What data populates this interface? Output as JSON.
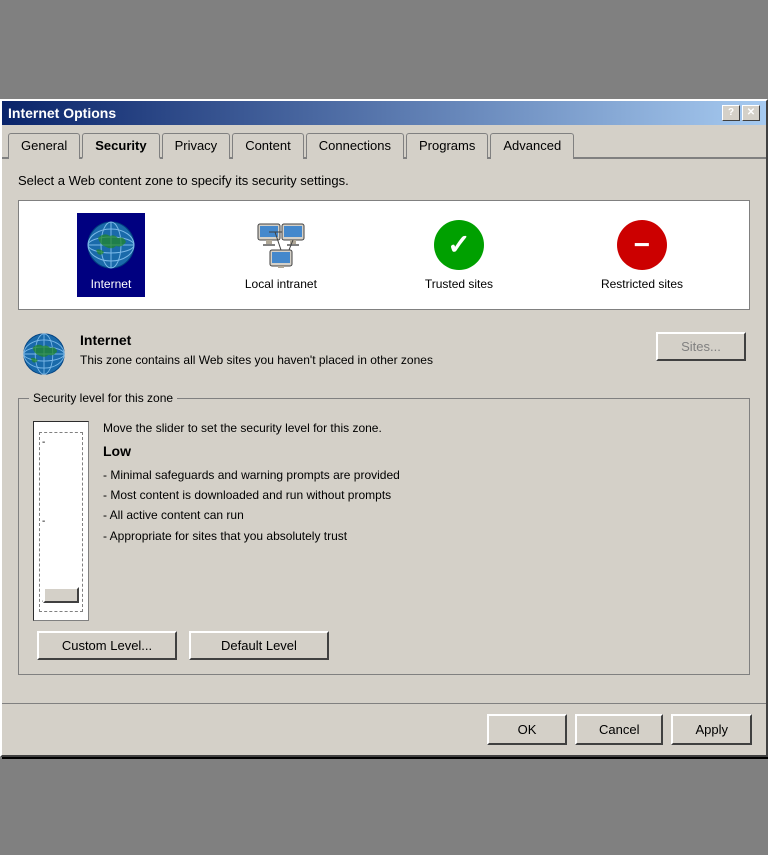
{
  "window": {
    "title": "Internet Options",
    "help_btn": "?",
    "close_btn": "✕"
  },
  "tabs": [
    {
      "id": "general",
      "label": "General"
    },
    {
      "id": "security",
      "label": "Security",
      "active": true
    },
    {
      "id": "privacy",
      "label": "Privacy"
    },
    {
      "id": "content",
      "label": "Content"
    },
    {
      "id": "connections",
      "label": "Connections"
    },
    {
      "id": "programs",
      "label": "Programs"
    },
    {
      "id": "advanced",
      "label": "Advanced"
    }
  ],
  "security_tab": {
    "description": "Select a Web content zone to specify its security settings.",
    "zones": [
      {
        "id": "internet",
        "label": "Internet",
        "selected": true
      },
      {
        "id": "local-intranet",
        "label": "Local intranet",
        "selected": false
      },
      {
        "id": "trusted-sites",
        "label": "Trusted sites",
        "selected": false
      },
      {
        "id": "restricted-sites",
        "label": "Restricted sites",
        "selected": false
      }
    ],
    "zone_info": {
      "title": "Internet",
      "description": "This zone contains all Web sites you haven't placed in other zones"
    },
    "sites_button": "Sites...",
    "security_group_label": "Security level for this zone",
    "slider_instruction": "Move the slider to set the security level for this zone.",
    "level_title": "Low",
    "level_bullets": [
      "- Minimal safeguards and warning prompts are provided",
      "- Most content is downloaded and run without prompts",
      "- All active content can run",
      "- Appropriate for sites that you absolutely trust"
    ],
    "ticks": [
      "-",
      "-",
      "-",
      "-"
    ],
    "custom_level_btn": "Custom Level...",
    "default_level_btn": "Default Level"
  },
  "footer": {
    "ok_label": "OK",
    "cancel_label": "Cancel",
    "apply_label": "Apply"
  }
}
